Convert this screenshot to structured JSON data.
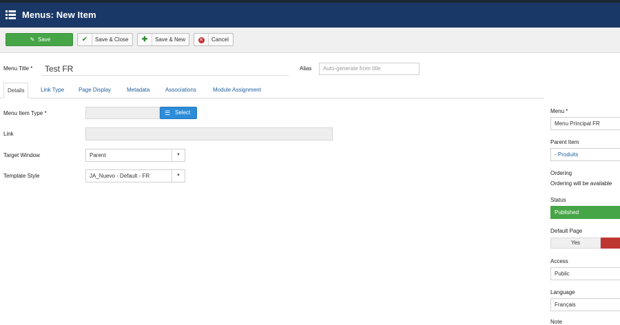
{
  "header": {
    "title": "Menus: New Item",
    "icon": "list-icon",
    "background": "#1a3867"
  },
  "toolbar": {
    "save": {
      "label": "Save",
      "icon": "edit-icon",
      "color": "#46a546"
    },
    "save_close": {
      "label": "Save & Close",
      "icon": "check-icon"
    },
    "save_new": {
      "label": "Save & New",
      "icon": "plus-icon"
    },
    "cancel": {
      "label": "Cancel",
      "icon": "cancel-icon"
    }
  },
  "form": {
    "menu_title_label": "Menu Title *",
    "menu_title_value": "Test FR",
    "alias_label": "Alias",
    "alias_placeholder": "Auto-generate from title"
  },
  "tabs": [
    "Details",
    "Link Type",
    "Page Display",
    "Metadata",
    "Associations",
    "Module Assignment"
  ],
  "details": {
    "menu_item_type_label": "Menu Item Type *",
    "select_label": "Select",
    "link_label": "Link",
    "target_window_label": "Target Window",
    "target_window_value": "Parent",
    "template_style_label": "Template Style",
    "template_style_value": "JA_Nuevo - Default - FR"
  },
  "sidebar": {
    "menu_label": "Menu *",
    "menu_value": "Menu Principal FR",
    "parent_label": "Parent Item",
    "parent_value": "- Produits",
    "ordering_label": "Ordering",
    "ordering_text": "Ordering will be available",
    "status_label": "Status",
    "status_value": "Published",
    "default_page_label": "Default Page",
    "default_yes": "Yes",
    "access_label": "Access",
    "access_value": "Public",
    "language_label": "Language",
    "language_value": "Français",
    "note_label": "Note"
  }
}
